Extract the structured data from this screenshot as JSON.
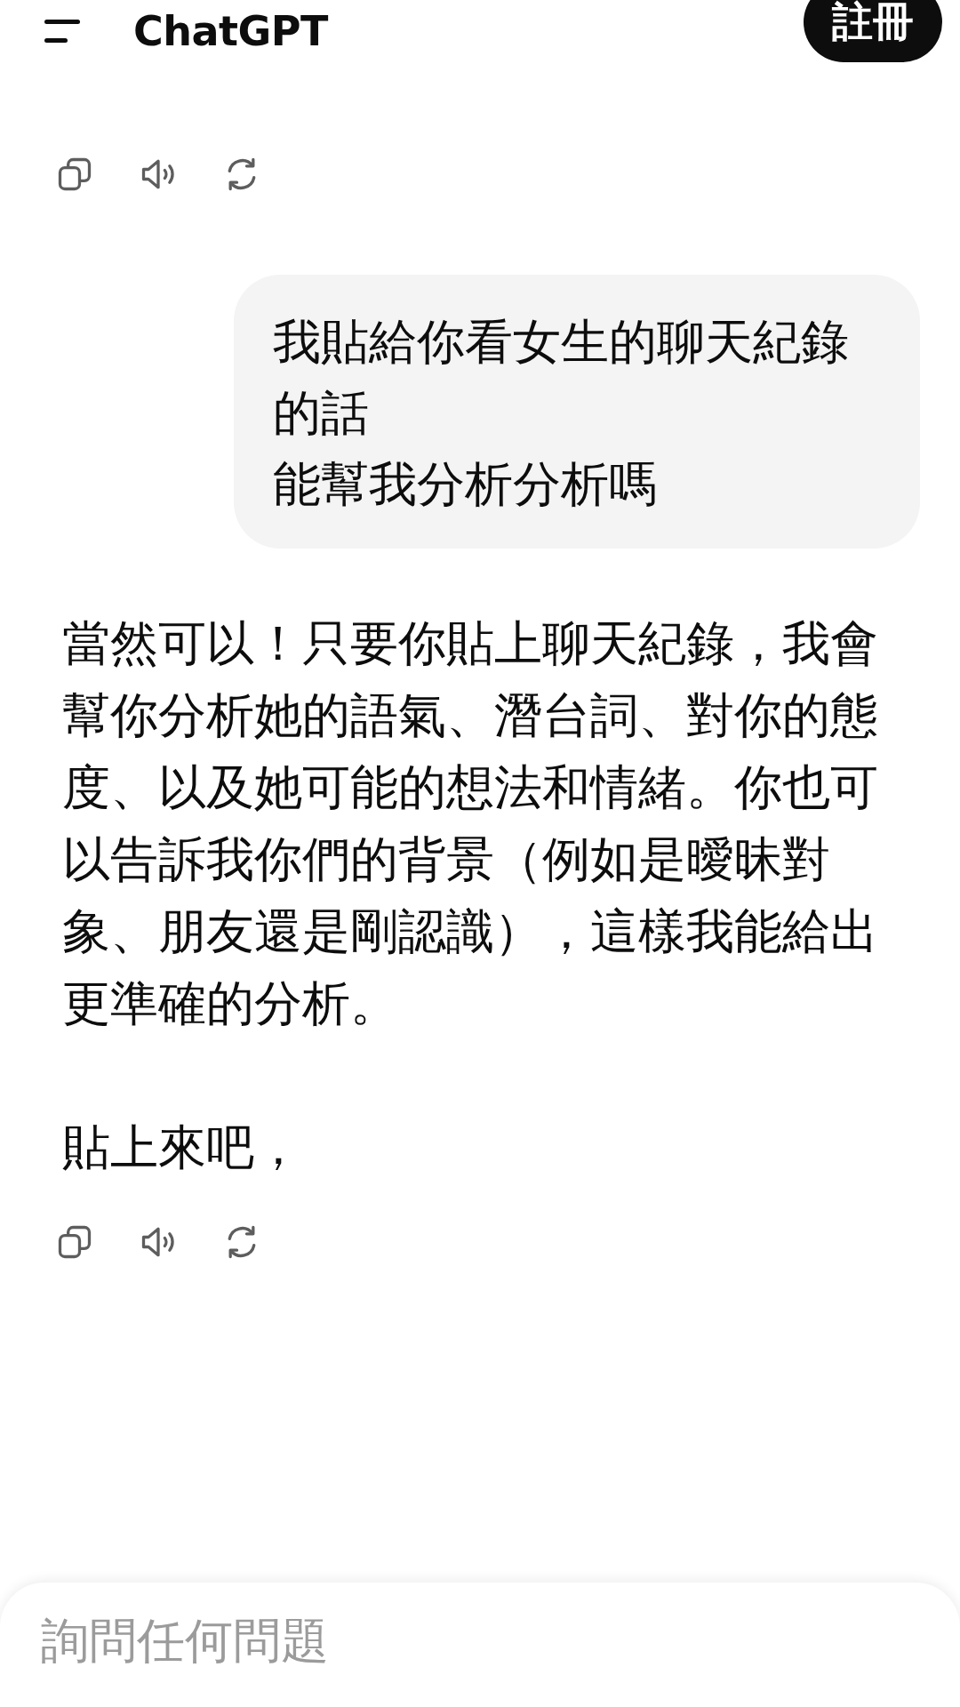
{
  "header": {
    "title": "ChatGPT",
    "signup_button": "註冊"
  },
  "messages": [
    {
      "kind": "actions"
    },
    {
      "kind": "user",
      "lines": [
        "我貼給你看女生的聊天紀錄的話",
        "能幫我分析分析嗎"
      ]
    },
    {
      "kind": "assistant",
      "paragraphs": [
        "當然可以！只要你貼上聊天紀錄，我會幫你分析她的語氣、潛台詞、對你的態度、以及她可能的想法和情緒。你也可以告訴我你們的背景（例如是曖昧對象、朋友還是剛認識），這樣我能給出更準確的分析。",
        "貼上來吧，"
      ]
    },
    {
      "kind": "actions"
    }
  ],
  "composer": {
    "placeholder": "詢問任何問題"
  }
}
